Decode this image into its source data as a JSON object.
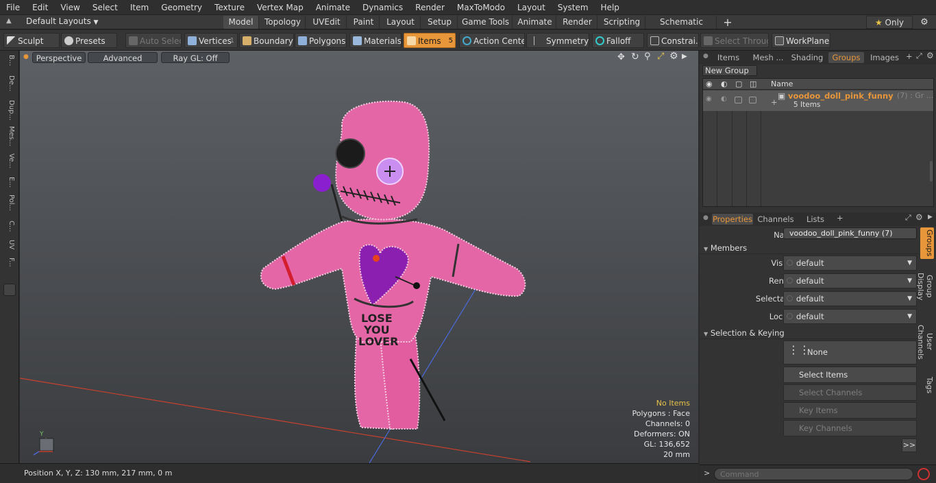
{
  "menu": [
    "File",
    "Edit",
    "View",
    "Select",
    "Item",
    "Geometry",
    "Texture",
    "Vertex Map",
    "Animate",
    "Dynamics",
    "Render",
    "MaxToModo",
    "Layout",
    "System",
    "Help"
  ],
  "layouts": {
    "label": "Default Layouts",
    "tabs": [
      "Model",
      "Topology",
      "UVEdit",
      "Paint",
      "Layout",
      "Setup",
      "Game Tools",
      "Animate",
      "Render",
      "Scripting",
      "Schematic Fusion"
    ],
    "active": "Model",
    "add": "+",
    "only": "Only"
  },
  "toolbar": {
    "sculpt": "Sculpt",
    "presets": "Presets",
    "auto_select": "Auto Select",
    "vertices": "Vertices",
    "vertices_count": "1",
    "boundary": "Boundary",
    "polygons": "Polygons",
    "materials": "Materials",
    "items": "Items",
    "items_count": "5",
    "action_center": "Action Center",
    "symmetry": "Symmetry",
    "falloff": "Falloff",
    "constraints": "Constrai...",
    "select_through": "Select Through",
    "workplane": "WorkPlane"
  },
  "left_strip": [
    "B...",
    "De...",
    "Dup...",
    "Mes...",
    "Ve...",
    "E...",
    "Pol...",
    "C...",
    "UV",
    "F..."
  ],
  "viewport": {
    "view": "Perspective",
    "advanced": "Advanced",
    "raygl": "Ray GL: Off",
    "doll_text": [
      "LOSE",
      "YOU",
      "LOVER"
    ],
    "axis_label": "Y",
    "stats": {
      "no_items": "No Items",
      "polygons": "Polygons : Face",
      "channels": "Channels: 0",
      "deformers": "Deformers: ON",
      "gl": "GL: 136,652",
      "scale": "20 mm"
    }
  },
  "statusbar": {
    "position": "Position X, Y, Z:   130 mm, 217 mm, 0 m"
  },
  "groups_panel": {
    "tabs": [
      "Items",
      "Mesh ...",
      "Shading",
      "Groups",
      "Images"
    ],
    "active": "Groups",
    "new_group": "New Group",
    "col_name": "Name",
    "group_name": "voodoo_doll_pink_funny",
    "group_suffix": "(7) : Gr ...",
    "group_items": "5 Items"
  },
  "properties": {
    "tabs": [
      "Properties",
      "Channels",
      "Lists"
    ],
    "active": "Properties",
    "name_label": "Name",
    "name_value": "voodoo_doll_pink_funny (7)",
    "members": "Members",
    "visible_label": "Visible",
    "visible": "default",
    "render_label": "Render",
    "render": "default",
    "selectable_label": "Selectable",
    "selectable": "default",
    "locked_label": "Locked",
    "locked": "default",
    "sel_keying": "Selection & Keying",
    "none": "None",
    "select_items": "Select Items",
    "select_channels": "Select Channels",
    "key_items": "Key Items",
    "key_channels": "Key Channels",
    "more": ">>",
    "vtabs": [
      "Groups",
      "Group Display",
      "User Channels",
      "Tags"
    ],
    "command_placeholder": "Command"
  },
  "colors": {
    "accent": "#e8963a",
    "doll_pink": "#e566a6",
    "heart_purple": "#8a1fb0"
  }
}
